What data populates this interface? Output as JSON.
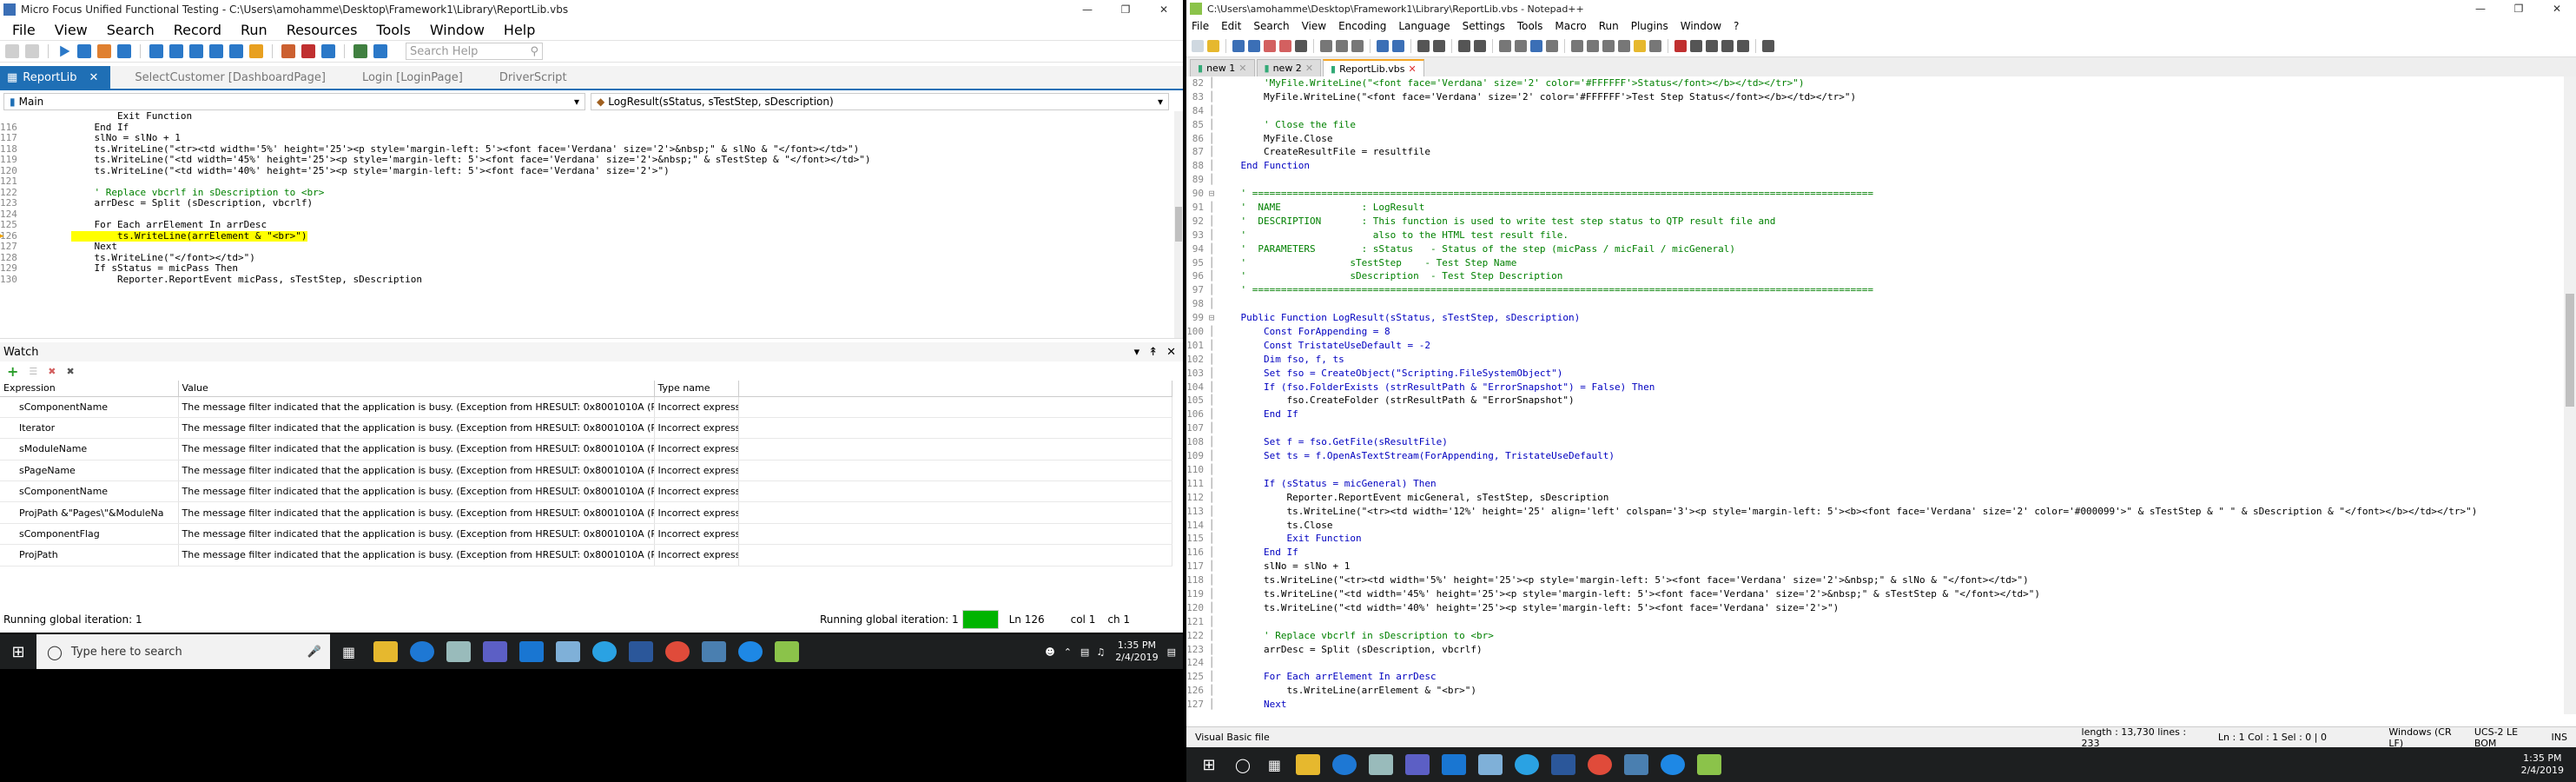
{
  "left": {
    "title": "Micro Focus Unified Functional Testing - C:\\Users\\amohamme\\Desktop\\Framework1\\Library\\ReportLib.vbs",
    "menu": [
      "File",
      "View",
      "Search",
      "Record",
      "Run",
      "Resources",
      "Tools",
      "Window",
      "Help"
    ],
    "search_placeholder": "Search Help",
    "tabs": [
      "ReportLib",
      "SelectCustomer [DashboardPage]",
      "Login [LoginPage]",
      "DriverScript"
    ],
    "combo_main": "Main",
    "combo_func": "LogResult(sStatus, sTestStep, sDescription)",
    "code": [
      {
        "n": "",
        "t": "        Exit Function"
      },
      {
        "n": "116",
        "t": "    End If"
      },
      {
        "n": "117",
        "t": "    slNo = slNo + 1"
      },
      {
        "n": "118",
        "t": "    ts.WriteLine(\"<tr><td width='5%' height='25'><p style='margin-left: 5'><font face='Verdana' size='2'>&nbsp;\" & slNo & \"</font></td>\")"
      },
      {
        "n": "119",
        "t": "    ts.WriteLine(\"<td width='45%' height='25'><p style='margin-left: 5'><font face='Verdana' size='2'>&nbsp;\" & sTestStep & \"</font></td>\")"
      },
      {
        "n": "120",
        "t": "    ts.WriteLine(\"<td width='40%' height='25'><p style='margin-left: 5'><font face='Verdana' size='2'>\")"
      },
      {
        "n": "121",
        "t": ""
      },
      {
        "n": "122",
        "t": "    ' Replace vbcrlf in sDescription to <br>"
      },
      {
        "n": "123",
        "t": "    arrDesc = Split (sDescription, vbcrlf)"
      },
      {
        "n": "124",
        "t": ""
      },
      {
        "n": "125",
        "t": "    For Each arrElement In arrDesc"
      },
      {
        "n": "126",
        "t": "        ts.WriteLine(arrElement & \"<br>\")"
      },
      {
        "n": "127",
        "t": "    Next"
      },
      {
        "n": "128",
        "t": "    ts.WriteLine(\"</font></td>\")"
      },
      {
        "n": "129",
        "t": "    If sStatus = micPass Then"
      },
      {
        "n": "130",
        "t": "        Reporter.ReportEvent micPass, sTestStep, sDescription"
      }
    ],
    "watch_title": "Watch",
    "watch_pin": "▾ p ×",
    "watch_cols": [
      "Expression",
      "Value",
      "Type name"
    ],
    "watch_rows": [
      {
        "e": "sComponentName",
        "v": "The message filter indicated that the application is busy. (Exception from HRESULT: 0x8001010A (RF",
        "t": "Incorrect express"
      },
      {
        "e": "Iterator",
        "v": "The message filter indicated that the application is busy. (Exception from HRESULT: 0x8001010A (RF",
        "t": "Incorrect express"
      },
      {
        "e": "sModuleName",
        "v": "The message filter indicated that the application is busy. (Exception from HRESULT: 0x8001010A (RF",
        "t": "Incorrect express"
      },
      {
        "e": "sPageName",
        "v": "The message filter indicated that the application is busy. (Exception from HRESULT: 0x8001010A (RF",
        "t": "Incorrect express"
      },
      {
        "e": "sComponentName",
        "v": "The message filter indicated that the application is busy. (Exception from HRESULT: 0x8001010A (RF",
        "t": "Incorrect express"
      },
      {
        "e": "ProjPath &\"Pages\\\"&ModuleNa",
        "v": "The message filter indicated that the application is busy. (Exception from HRESULT: 0x8001010A (RF",
        "t": "Incorrect express"
      },
      {
        "e": "sComponentFlag",
        "v": "The message filter indicated that the application is busy. (Exception from HRESULT: 0x8001010A (RF",
        "t": "Incorrect express"
      },
      {
        "e": "ProjPath",
        "v": "The message filter indicated that the application is busy. (Exception from HRESULT: 0x8001010A (RF",
        "t": "Incorrect express"
      }
    ],
    "status_left": "Running global iteration: 1",
    "status_mid": "Running global iteration: 1",
    "status_ln": "Ln 126",
    "status_col": "col 1",
    "status_ch": "ch 1",
    "progress": 1.0
  },
  "right": {
    "title": "C:\\Users\\amohamme\\Desktop\\Framework1\\Library\\ReportLib.vbs - Notepad++",
    "menu": [
      "File",
      "Edit",
      "Search",
      "View",
      "Encoding",
      "Language",
      "Settings",
      "Tools",
      "Macro",
      "Run",
      "Plugins",
      "Window",
      "?"
    ],
    "tabs": [
      "new 1",
      "new 2",
      "ReportLib.vbs"
    ],
    "code": [
      {
        "n": "82",
        "t": "        'MyFile.WriteLine(\"<font face='Verdana' size='2' color='#FFFFFF'>Status</font></b></td></tr>\")",
        "c": "cm"
      },
      {
        "n": "83",
        "t": "        MyFile.WriteLine(\"<font face='Verdana' size='2' color='#FFFFFF'>Test Step Status</font></b></td></tr>\")"
      },
      {
        "n": "84",
        "t": ""
      },
      {
        "n": "85",
        "t": "        ' Close the file",
        "c": "cm"
      },
      {
        "n": "86",
        "t": "        MyFile.Close"
      },
      {
        "n": "87",
        "t": "        CreateResultFile = resultfile"
      },
      {
        "n": "88",
        "t": "    End Function"
      },
      {
        "n": "89",
        "t": ""
      },
      {
        "n": "90",
        "t": "    ' ============================================================================================================",
        "c": "cm"
      },
      {
        "n": "91",
        "t": "    '  NAME              : LogResult",
        "c": "cm"
      },
      {
        "n": "92",
        "t": "    '  DESCRIPTION       : This function is used to write test step status to QTP result file and",
        "c": "cm"
      },
      {
        "n": "93",
        "t": "    '                      also to the HTML test result file.",
        "c": "cm"
      },
      {
        "n": "94",
        "t": "    '  PARAMETERS        : sStatus   - Status of the step (micPass / micFail / micGeneral)",
        "c": "cm"
      },
      {
        "n": "95",
        "t": "    '                  sTestStep    - Test Step Name",
        "c": "cm"
      },
      {
        "n": "96",
        "t": "    '                  sDescription  - Test Step Description",
        "c": "cm"
      },
      {
        "n": "97",
        "t": "    ' ============================================================================================================",
        "c": "cm"
      },
      {
        "n": "98",
        "t": ""
      },
      {
        "n": "99",
        "t": "    Public Function LogResult(sStatus, sTestStep, sDescription)"
      },
      {
        "n": "100",
        "t": "        Const ForAppending = 8"
      },
      {
        "n": "101",
        "t": "        Const TristateUseDefault = -2"
      },
      {
        "n": "102",
        "t": "        Dim fso, f, ts"
      },
      {
        "n": "103",
        "t": "        Set fso = CreateObject(\"Scripting.FileSystemObject\")"
      },
      {
        "n": "104",
        "t": "        If (fso.FolderExists (strResultPath & \"ErrorSnapshot\") = False) Then"
      },
      {
        "n": "105",
        "t": "            fso.CreateFolder (strResultPath & \"ErrorSnapshot\")"
      },
      {
        "n": "106",
        "t": "        End If"
      },
      {
        "n": "107",
        "t": ""
      },
      {
        "n": "108",
        "t": "        Set f = fso.GetFile(sResultFile)"
      },
      {
        "n": "109",
        "t": "        Set ts = f.OpenAsTextStream(ForAppending, TristateUseDefault)"
      },
      {
        "n": "110",
        "t": ""
      },
      {
        "n": "111",
        "t": "        If (sStatus = micGeneral) Then"
      },
      {
        "n": "112",
        "t": "            Reporter.ReportEvent micGeneral, sTestStep, sDescription"
      },
      {
        "n": "113",
        "t": "            ts.WriteLine(\"<tr><td width='12%' height='25' align='left' colspan='3'><p style='margin-left: 5'><b><font face='Verdana' size='2' color='#000099'>\" & sTestStep & \" \" & sDescription & \"</font></b></td></tr>\")"
      },
      {
        "n": "114",
        "t": "            ts.Close"
      },
      {
        "n": "115",
        "t": "            Exit Function"
      },
      {
        "n": "116",
        "t": "        End If"
      },
      {
        "n": "117",
        "t": "        slNo = slNo + 1"
      },
      {
        "n": "118",
        "t": "        ts.WriteLine(\"<tr><td width='5%' height='25'><p style='margin-left: 5'><font face='Verdana' size='2'>&nbsp;\" & slNo & \"</font></td>\")"
      },
      {
        "n": "119",
        "t": "        ts.WriteLine(\"<td width='45%' height='25'><p style='margin-left: 5'><font face='Verdana' size='2'>&nbsp;\" & sTestStep & \"</font></td>\")"
      },
      {
        "n": "120",
        "t": "        ts.WriteLine(\"<td width='40%' height='25'><p style='margin-left: 5'><font face='Verdana' size='2'>\")"
      },
      {
        "n": "121",
        "t": ""
      },
      {
        "n": "122",
        "t": "        ' Replace vbcrlf in sDescription to <br>",
        "c": "cm"
      },
      {
        "n": "123",
        "t": "        arrDesc = Split (sDescription, vbcrlf)"
      },
      {
        "n": "124",
        "t": ""
      },
      {
        "n": "125",
        "t": "        For Each arrElement In arrDesc"
      },
      {
        "n": "126",
        "t": "            ts.WriteLine(arrElement & \"<br>\")"
      },
      {
        "n": "127",
        "t": "        Next"
      }
    ],
    "status_lang": "Visual Basic file",
    "status_len": "length : 13,730   lines : 233",
    "status_pos": "Ln : 1   Col : 1   Sel : 0 | 0",
    "status_eol": "Windows (CR LF)",
    "status_enc": "UCS-2 LE BOM",
    "status_ins": "INS"
  },
  "taskbar": {
    "search_placeholder": "Type here to search",
    "time": "1:35 PM",
    "date": "2/4/2019"
  },
  "colors": {
    "accent": "#1f6fb5",
    "highlight": "#ffff00",
    "keyword": "#0000ff",
    "comment": "#008000",
    "progress": "#00b400"
  }
}
